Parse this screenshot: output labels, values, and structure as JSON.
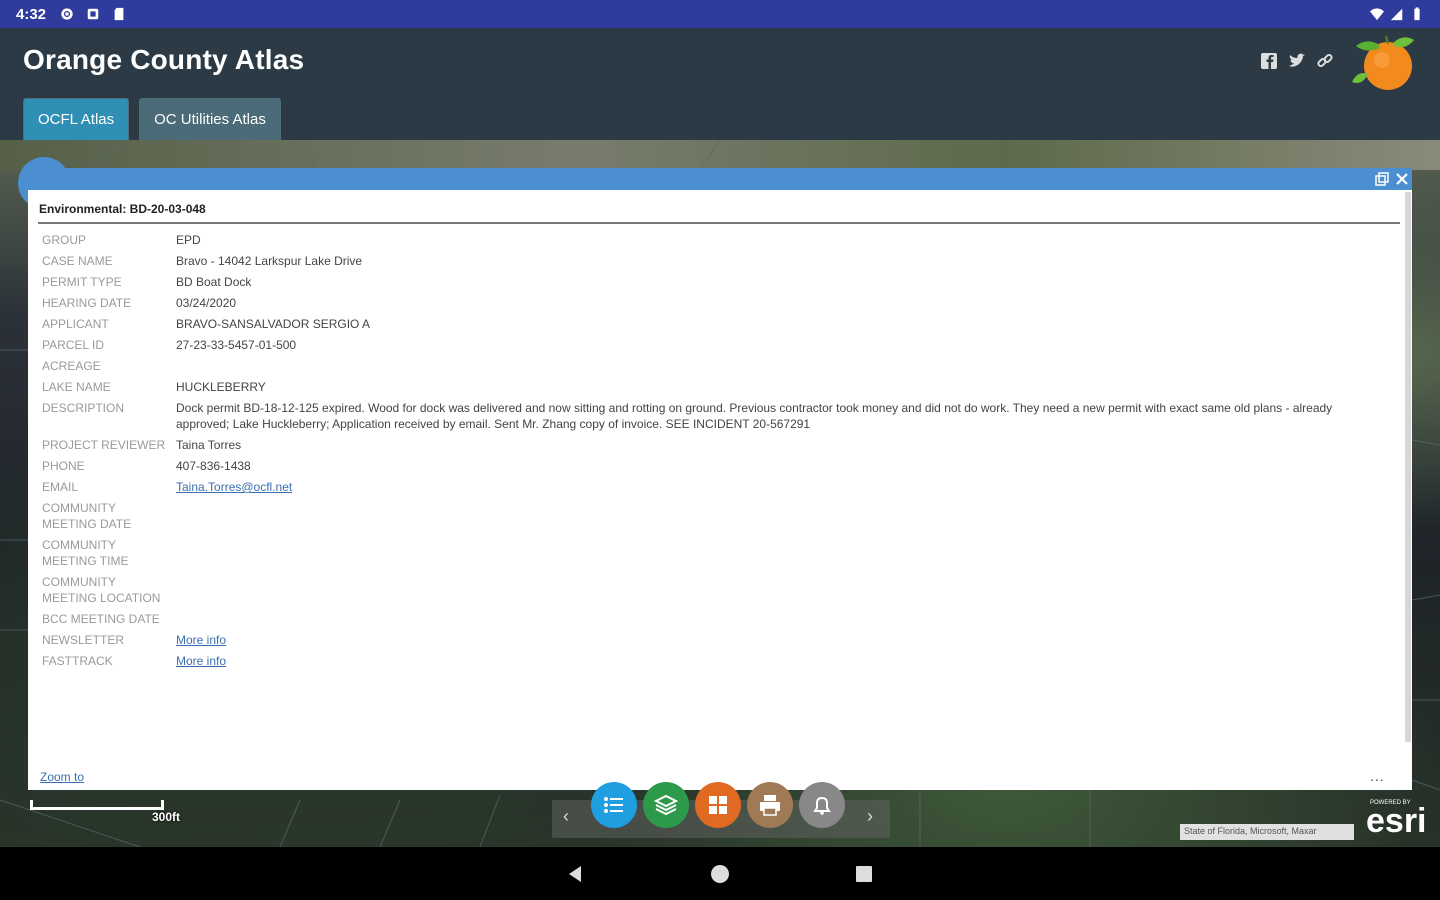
{
  "status_bar": {
    "time": "4:32",
    "left_icons": [
      "gear-icon",
      "notification-icon",
      "sd-card-icon"
    ],
    "right_icons": [
      "wifi-icon",
      "signal-icon",
      "battery-icon"
    ]
  },
  "app": {
    "title": "Orange County Atlas",
    "share_icons": [
      "facebook-icon",
      "twitter-icon",
      "link-icon"
    ],
    "logo": "orange-logo",
    "tabs": [
      {
        "label": "OCFL Atlas",
        "active": true
      },
      {
        "label": "OC Utilities Atlas",
        "active": false
      }
    ]
  },
  "popup": {
    "title": "Environmental: BD-20-03-048",
    "rows": [
      {
        "label": "GROUP",
        "value": "EPD"
      },
      {
        "label": "CASE NAME",
        "value": "Bravo - 14042 Larkspur Lake Drive"
      },
      {
        "label": "PERMIT TYPE",
        "value": "BD Boat Dock"
      },
      {
        "label": "HEARING DATE",
        "value": "03/24/2020"
      },
      {
        "label": "APPLICANT",
        "value": "BRAVO-SANSALVADOR SERGIO A"
      },
      {
        "label": "PARCEL ID",
        "value": "27-23-33-5457-01-500"
      },
      {
        "label": "ACREAGE",
        "value": ""
      },
      {
        "label": "LAKE NAME",
        "value": "HUCKLEBERRY"
      },
      {
        "label": "DESCRIPTION",
        "value": "Dock permit BD-18-12-125 expired. Wood for dock was delivered and now sitting and rotting on ground. Previous contractor took money and did not do work. They need a new permit with exact same old plans - already approved; Lake Huckleberry; Application received by email. Sent Mr. Zhang copy of invoice. SEE INCIDENT 20-567291"
      },
      {
        "label": "PROJECT REVIEWER",
        "value": "Taina Torres"
      },
      {
        "label": "PHONE",
        "value": "407-836-1438"
      },
      {
        "label": "EMAIL",
        "value": "Taina.Torres@ocfl.net",
        "link": true
      },
      {
        "label": "COMMUNITY MEETING DATE",
        "value": ""
      },
      {
        "label": "COMMUNITY MEETING TIME",
        "value": ""
      },
      {
        "label": "COMMUNITY MEETING LOCATION",
        "value": ""
      },
      {
        "label": "BCC MEETING DATE",
        "value": ""
      },
      {
        "label": "NEWSLETTER",
        "value": "More info",
        "link": true
      },
      {
        "label": "FASTTRACK",
        "value": "More info",
        "link": true
      }
    ],
    "zoom_link": "Zoom to",
    "more_menu": "...",
    "close_icon": "close-icon",
    "restore_icon": "restore-icon"
  },
  "map": {
    "scale_label": "300ft",
    "attribution": "State of Florida, Microsoft, Maxar",
    "esri_logo": "esri",
    "esri_powered": "POWERED BY",
    "toolbar": {
      "prev": "‹",
      "next": "›",
      "buttons": [
        {
          "icon": "list-icon",
          "color": "#1f9fe0"
        },
        {
          "icon": "layers-icon",
          "color": "#2c9a4a"
        },
        {
          "icon": "basemap-grid-icon",
          "color": "#e06a22"
        },
        {
          "icon": "print-icon",
          "color": "#a07a55"
        },
        {
          "icon": "alert-bell-icon",
          "color": "#888888"
        }
      ]
    }
  },
  "nav_bar": {
    "buttons": [
      "back-icon",
      "home-icon",
      "recents-icon"
    ]
  }
}
